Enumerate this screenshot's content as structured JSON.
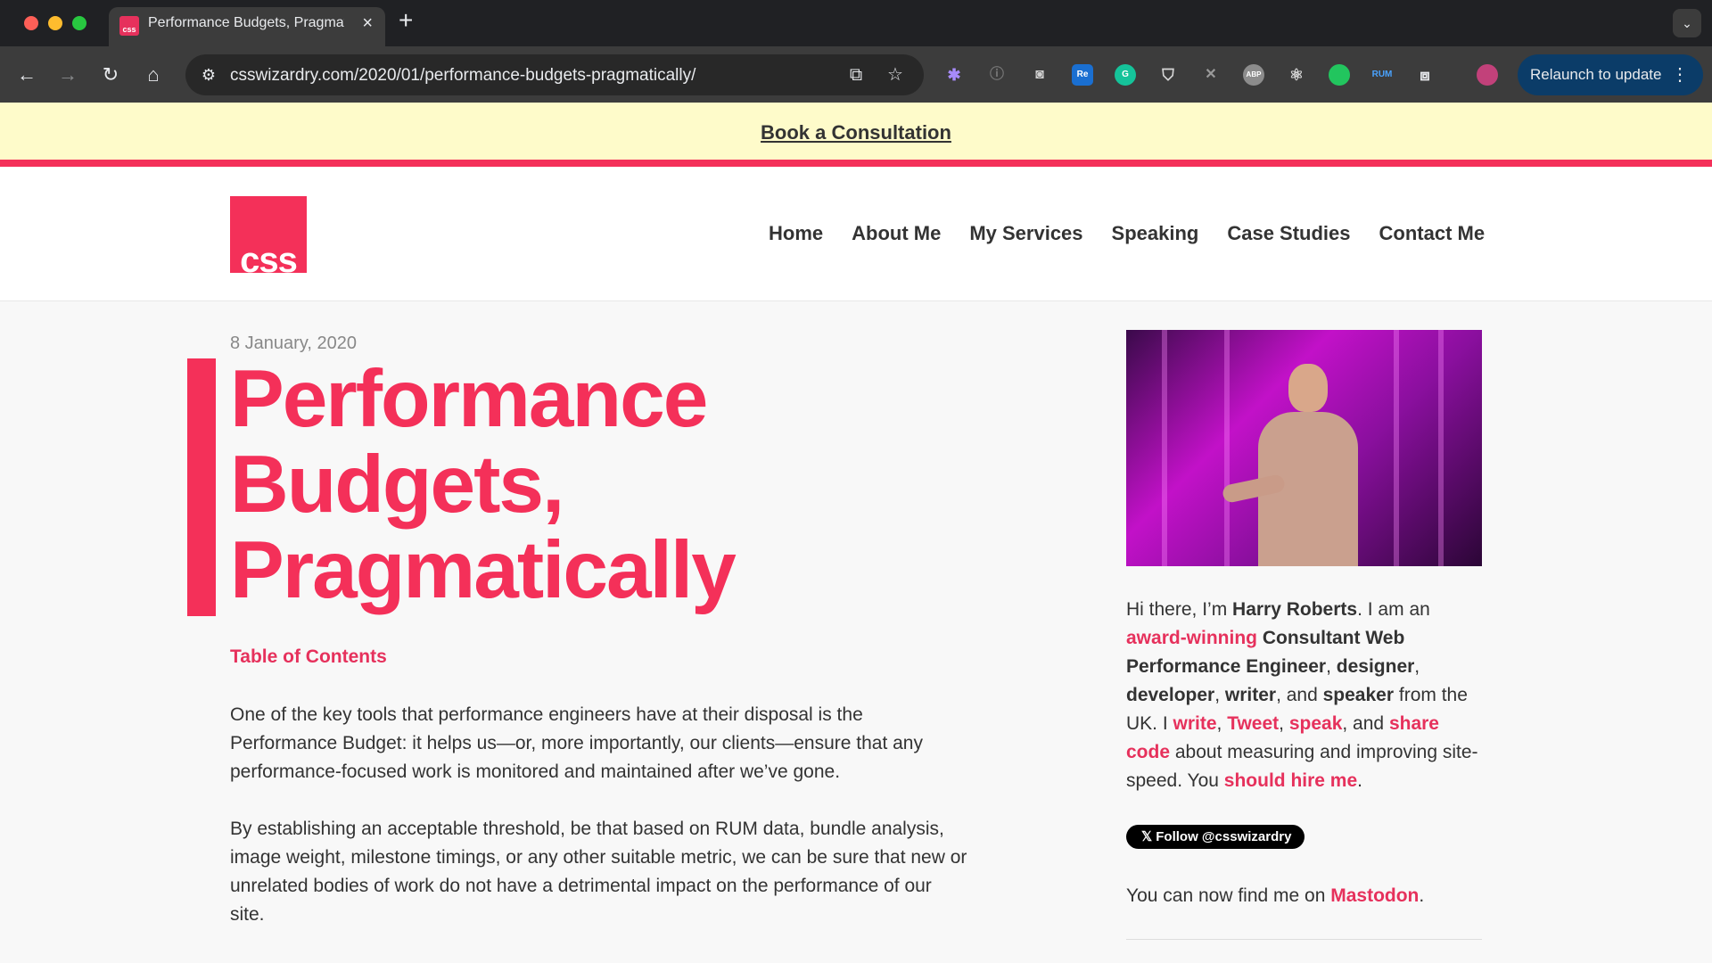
{
  "browser": {
    "tab_title": "Performance Budgets, Pragmatically",
    "tab_favicon_text": "css",
    "url": "csswizardry.com/2020/01/performance-budgets-pragmatically/",
    "relaunch_label": "Relaunch to update",
    "extensions": [
      "puzzle-gear-icon",
      "info-icon",
      "camera-icon",
      "readcube-icon",
      "grammarly-icon",
      "shield-icon",
      "pin-icon",
      "abp-icon",
      "react-icon",
      "green-dot-icon",
      "rum-icon",
      "extensions-icon",
      "profile-avatar"
    ],
    "ext_labels": {
      "readcube": "Re",
      "abp": "ABP",
      "rum": "RUM"
    }
  },
  "site": {
    "banner_link": "Book a Consultation",
    "logo_text": "css",
    "nav": [
      "Home",
      "About Me",
      "My Services",
      "Speaking",
      "Case Studies",
      "Contact Me"
    ],
    "accent_color": "#f43059"
  },
  "article": {
    "date": "8 January, 2020",
    "title": "Performance Budgets, Pragmatically",
    "toc_label": "Table of Contents",
    "paragraphs": [
      "One of the key tools that performance engineers have at their disposal is the Performance Budget: it helps us—or, more importantly, our clients—ensure that any performance-focused work is monitored and maintained after we’ve gone.",
      "By establishing an acceptable threshold, be that based on RUM data, bundle analysis, image weight, milestone timings, or any other suitable metric, we can be sure that new or unrelated bodies of work do not have a detrimental impact on the performance of our site."
    ]
  },
  "sidebar": {
    "bio": {
      "t1": "Hi there, I’m ",
      "name": "Harry Roberts",
      "t2": ". I am an ",
      "award": "award-winning",
      "t3": " ",
      "role": "Consultant Web Performance Engineer",
      "t4": ", ",
      "designer": "designer",
      "t5": ", ",
      "developer": "developer",
      "t6": ", ",
      "writer": "writer",
      "t7": ", and ",
      "speaker": "speaker",
      "t8": " from the UK. I ",
      "write": "write",
      "t9": ", ",
      "tweet": "Tweet",
      "t10": ", ",
      "speak": "speak",
      "t11": ", and ",
      "share_code": "share code",
      "t12": " about measuring and improving site-speed. You ",
      "hire": "should hire me",
      "t13": "."
    },
    "follow_button": "Follow @csswizardry",
    "mastodon_prefix": "You can now find me on ",
    "mastodon_link": "Mastodon",
    "mastodon_suffix": "."
  }
}
